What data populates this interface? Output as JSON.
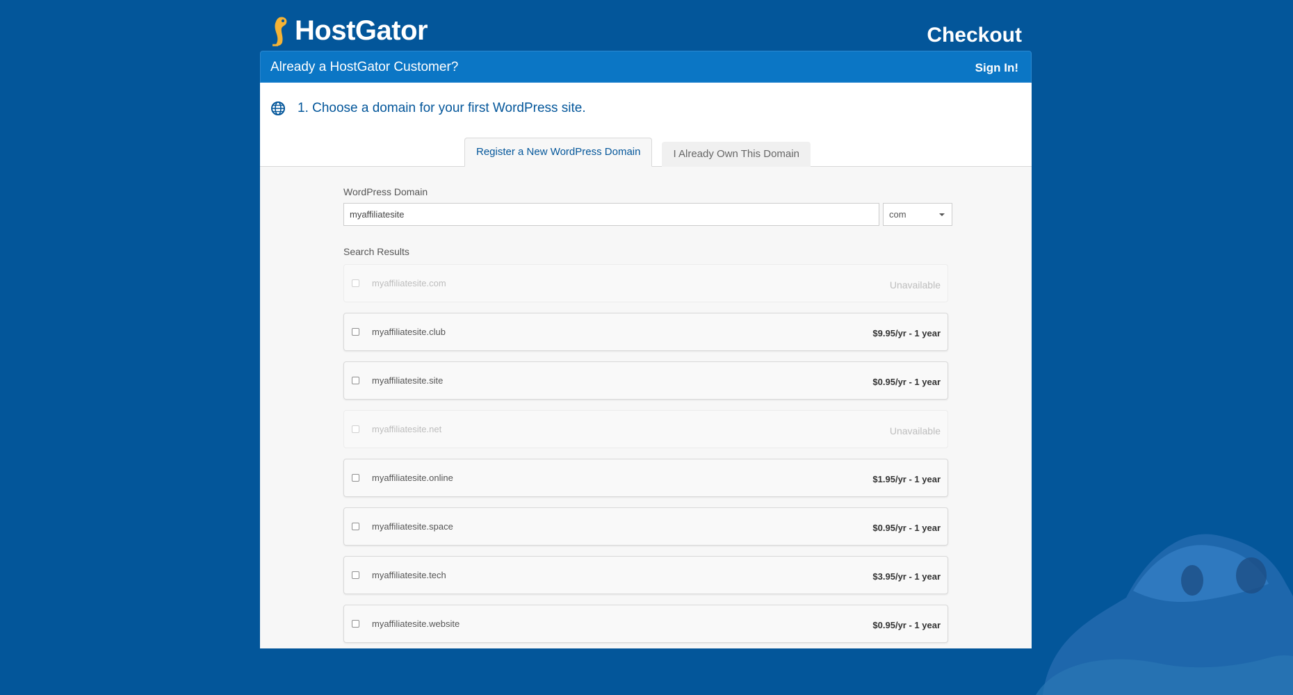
{
  "header": {
    "logo_text": "HostGator",
    "page_title": "Checkout"
  },
  "customer_bar": {
    "text": "Already a HostGator Customer?",
    "signin_label": "Sign In!"
  },
  "step": {
    "title": "1. Choose a domain for your first WordPress site."
  },
  "tabs": [
    {
      "label": "Register a New WordPress Domain",
      "active": true
    },
    {
      "label": "I Already Own This Domain",
      "active": false
    }
  ],
  "domain_form": {
    "label": "WordPress Domain",
    "value": "myaffiliatesite",
    "tld_selected": "com"
  },
  "results": {
    "label": "Search Results",
    "items": [
      {
        "domain": "myaffiliatesite.com",
        "price": "Unavailable",
        "available": false
      },
      {
        "domain": "myaffiliatesite.club",
        "price": "$9.95/yr - 1 year",
        "available": true
      },
      {
        "domain": "myaffiliatesite.site",
        "price": "$0.95/yr - 1 year",
        "available": true
      },
      {
        "domain": "myaffiliatesite.net",
        "price": "Unavailable",
        "available": false
      },
      {
        "domain": "myaffiliatesite.online",
        "price": "$1.95/yr - 1 year",
        "available": true
      },
      {
        "domain": "myaffiliatesite.space",
        "price": "$0.95/yr - 1 year",
        "available": true
      },
      {
        "domain": "myaffiliatesite.tech",
        "price": "$3.95/yr - 1 year",
        "available": true
      },
      {
        "domain": "myaffiliatesite.website",
        "price": "$0.95/yr - 1 year",
        "available": true
      }
    ]
  },
  "colors": {
    "background": "#03569a",
    "bar": "#0b76c5",
    "accent_text": "#03569a",
    "mascot": "#2f7cc4"
  }
}
